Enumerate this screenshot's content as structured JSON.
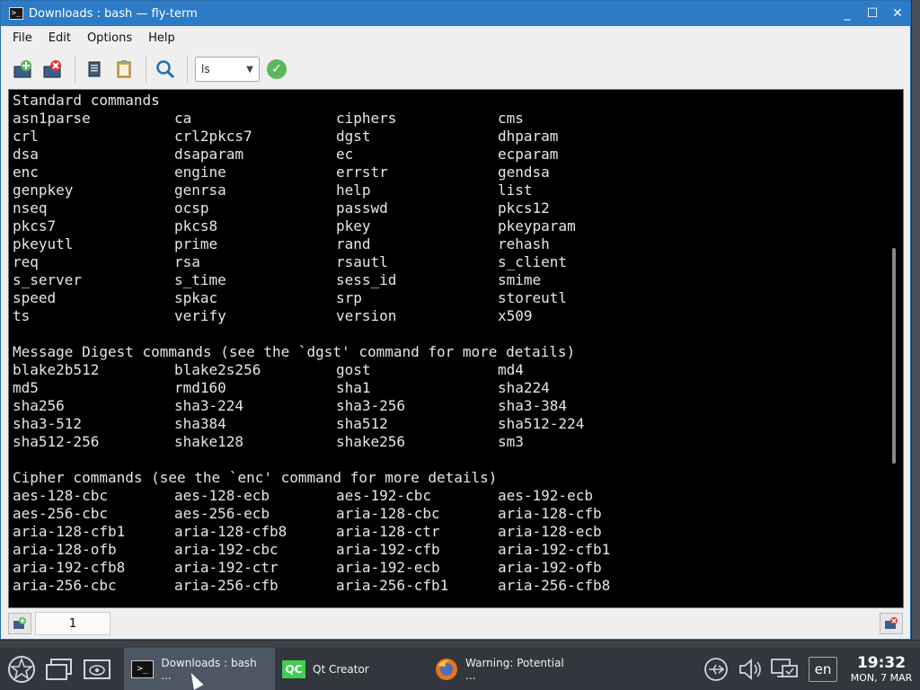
{
  "window": {
    "title": "Downloads : bash — fly-term",
    "controls": [
      "_",
      "☐",
      "✕"
    ]
  },
  "menubar": [
    "File",
    "Edit",
    "Options",
    "Help"
  ],
  "toolbar": {
    "command_select": "ls"
  },
  "terminal": {
    "sections": [
      {
        "heading": "Standard commands",
        "rows": [
          [
            "asn1parse",
            "ca",
            "ciphers",
            "cms"
          ],
          [
            "crl",
            "crl2pkcs7",
            "dgst",
            "dhparam"
          ],
          [
            "dsa",
            "dsaparam",
            "ec",
            "ecparam"
          ],
          [
            "enc",
            "engine",
            "errstr",
            "gendsa"
          ],
          [
            "genpkey",
            "genrsa",
            "help",
            "list"
          ],
          [
            "nseq",
            "ocsp",
            "passwd",
            "pkcs12"
          ],
          [
            "pkcs7",
            "pkcs8",
            "pkey",
            "pkeyparam"
          ],
          [
            "pkeyutl",
            "prime",
            "rand",
            "rehash"
          ],
          [
            "req",
            "rsa",
            "rsautl",
            "s_client"
          ],
          [
            "s_server",
            "s_time",
            "sess_id",
            "smime"
          ],
          [
            "speed",
            "spkac",
            "srp",
            "storeutl"
          ],
          [
            "ts",
            "verify",
            "version",
            "x509"
          ]
        ]
      },
      {
        "heading": "Message Digest commands (see the `dgst' command for more details)",
        "rows": [
          [
            "blake2b512",
            "blake2s256",
            "gost",
            "md4"
          ],
          [
            "md5",
            "rmd160",
            "sha1",
            "sha224"
          ],
          [
            "sha256",
            "sha3-224",
            "sha3-256",
            "sha3-384"
          ],
          [
            "sha3-512",
            "sha384",
            "sha512",
            "sha512-224"
          ],
          [
            "sha512-256",
            "shake128",
            "shake256",
            "sm3"
          ]
        ]
      },
      {
        "heading": "Cipher commands (see the `enc' command for more details)",
        "rows": [
          [
            "aes-128-cbc",
            "aes-128-ecb",
            "aes-192-cbc",
            "aes-192-ecb"
          ],
          [
            "aes-256-cbc",
            "aes-256-ecb",
            "aria-128-cbc",
            "aria-128-cfb"
          ],
          [
            "aria-128-cfb1",
            "aria-128-cfb8",
            "aria-128-ctr",
            "aria-128-ecb"
          ],
          [
            "aria-128-ofb",
            "aria-192-cbc",
            "aria-192-cfb",
            "aria-192-cfb1"
          ],
          [
            "aria-192-cfb8",
            "aria-192-ctr",
            "aria-192-ecb",
            "aria-192-ofb"
          ],
          [
            "aria-256-cbc",
            "aria-256-cfb",
            "aria-256-cfb1",
            "aria-256-cfb8"
          ]
        ]
      }
    ]
  },
  "statusbar": {
    "tab_label": "1"
  },
  "taskbar": {
    "tasks": [
      {
        "label": "Downloads : bash ...",
        "active": true
      },
      {
        "label": "Qt Creator",
        "active": false
      },
      {
        "label": "Warning: Potential ...",
        "active": false
      }
    ],
    "qt_icon_text": "QC",
    "language": "en",
    "time": "19:32",
    "date": "MON, 7 MAR"
  },
  "colors": {
    "titlebar": "#2d7bc6",
    "terminal_bg": "#000000",
    "terminal_fg": "#e6e6e6",
    "taskbar": "#32373d"
  }
}
